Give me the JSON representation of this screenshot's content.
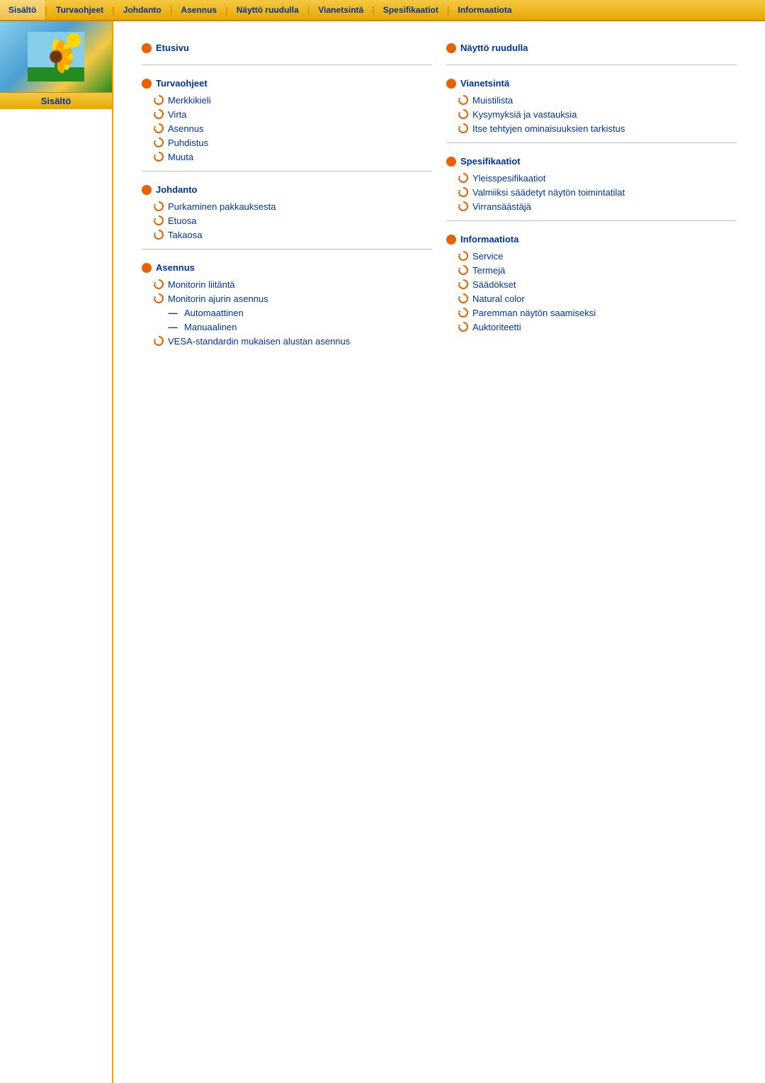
{
  "nav": {
    "items": [
      {
        "label": "Sisältö",
        "active": true
      },
      {
        "label": "Turvaohjeet",
        "active": false
      },
      {
        "label": "Johdanto",
        "active": false
      },
      {
        "label": "Asennus",
        "active": false
      },
      {
        "label": "Näyttö ruudulla",
        "active": false
      },
      {
        "label": "Vianetsintä",
        "active": false
      },
      {
        "label": "Spesifikaatiot",
        "active": false
      },
      {
        "label": "Informaatiota",
        "active": false
      }
    ]
  },
  "sidebar": {
    "label": "Sisältö"
  },
  "sections": {
    "col1": [
      {
        "id": "etusivu",
        "heading": "Etusivu",
        "items": []
      },
      {
        "id": "turvaohjeet",
        "heading": "Turvaohjeet",
        "items": [
          {
            "type": "g",
            "label": "Merkkikieli"
          },
          {
            "type": "g",
            "label": "Virta"
          },
          {
            "type": "g",
            "label": "Asennus"
          },
          {
            "type": "g",
            "label": "Puhdistus"
          },
          {
            "type": "g",
            "label": "Muuta"
          }
        ]
      },
      {
        "id": "johdanto",
        "heading": "Johdanto",
        "items": [
          {
            "type": "g",
            "label": "Purkaminen pakkauksesta"
          },
          {
            "type": "g",
            "label": "Etuosa"
          },
          {
            "type": "g",
            "label": "Takaosa"
          }
        ]
      },
      {
        "id": "asennus",
        "heading": "Asennus",
        "items": [
          {
            "type": "g",
            "label": "Monitorin liitäntä"
          },
          {
            "type": "g",
            "label": "Monitorin ajurin asennus"
          },
          {
            "type": "dash",
            "label": "Automaattinen"
          },
          {
            "type": "dash",
            "label": "Manuaalinen"
          },
          {
            "type": "g",
            "label": "VESA-standardin mukaisen alustan asennus"
          }
        ]
      }
    ],
    "col2": [
      {
        "id": "naytto-ruudulla",
        "heading": "Näyttö ruudulla",
        "items": []
      },
      {
        "id": "vianetsinta",
        "heading": "Vianetsintä",
        "items": [
          {
            "type": "g",
            "label": "Muistilista"
          },
          {
            "type": "g",
            "label": "Kysymyksiä ja vastauksia"
          },
          {
            "type": "g",
            "label": "Itse tehtyjen ominaisuuksien tarkistus"
          }
        ]
      },
      {
        "id": "spesifikaatiot",
        "heading": "Spesifikaatiot",
        "items": [
          {
            "type": "g",
            "label": "Yleisspesifikaatiot"
          },
          {
            "type": "g",
            "label": "Valmiiksi säädetyt näytön toimintatilat"
          },
          {
            "type": "g",
            "label": "Virransäästäjä"
          }
        ]
      },
      {
        "id": "informaatiota",
        "heading": "Informaatiota",
        "items": [
          {
            "type": "g",
            "label": "Service"
          },
          {
            "type": "g",
            "label": "Termejä"
          },
          {
            "type": "g",
            "label": "Säädökset"
          },
          {
            "type": "g",
            "label": "Natural color"
          },
          {
            "type": "g",
            "label": "Paremman näytön saamiseksi"
          },
          {
            "type": "g",
            "label": "Auktoriteetti"
          }
        ]
      }
    ]
  }
}
